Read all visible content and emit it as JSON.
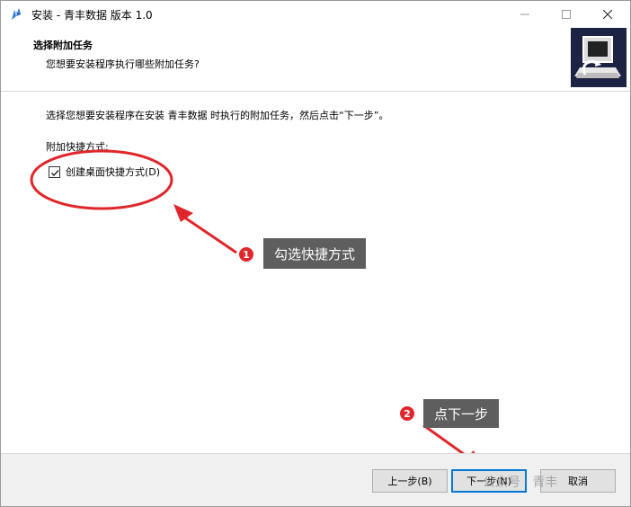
{
  "window": {
    "title": "安装 - 青丰数据 版本 1.0"
  },
  "header": {
    "title": "选择附加任务",
    "subtitle": "您想要安装程序执行哪些附加任务?"
  },
  "content": {
    "instruction": "选择您想要安装程序在安装 青丰数据 时执行的附加任务，然后点击“下一步”。",
    "group_label": "附加快捷方式:",
    "checkbox": {
      "label": "创建桌面快捷方式(D)",
      "checked": true
    }
  },
  "annotations": [
    {
      "number": "1",
      "text": "勾选快捷方式"
    },
    {
      "number": "2",
      "text": "点下一步"
    }
  ],
  "buttons": {
    "back": "上一步(B)",
    "next": "下一步(N)",
    "cancel": "取消"
  },
  "watermark": "公众号 · 青丰",
  "colors": {
    "annotation_red": "#e0262b",
    "callout_bg": "#5e5e5e",
    "header_image_bg": "#1d2342",
    "focus_blue": "#0078d7"
  }
}
